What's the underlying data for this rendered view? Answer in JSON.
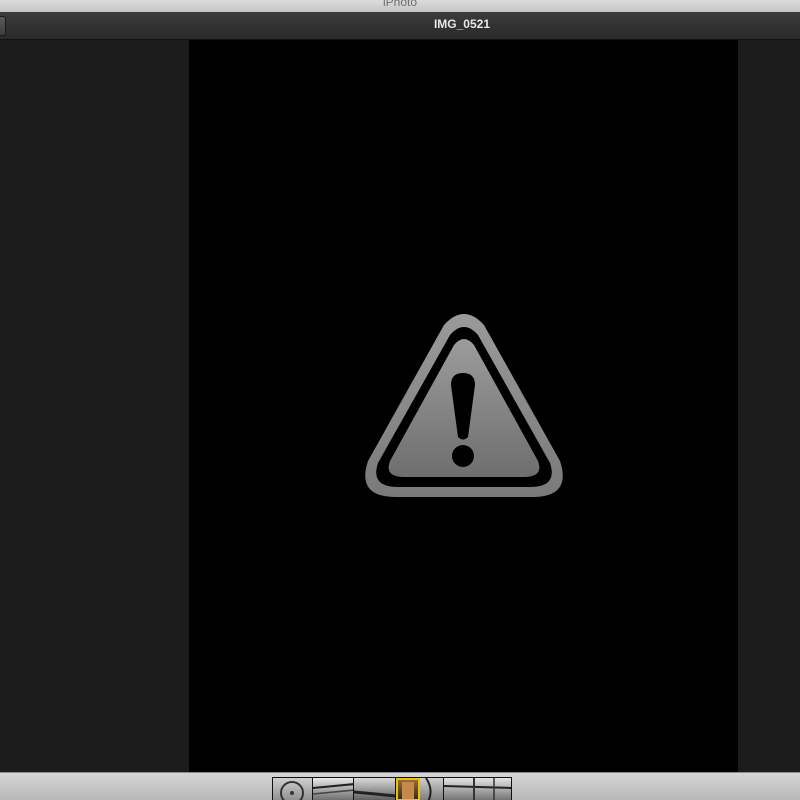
{
  "window": {
    "app_title": "iPhoto"
  },
  "viewer": {
    "photo_title": "IMG_0521",
    "icon": "warning-icon"
  },
  "filmstrip": {
    "thumbnails": [
      {
        "icon": "wheel-thumbnail"
      },
      {
        "icon": "bicycle-thumbnail"
      },
      {
        "icon": "bicycle-thumbnail"
      },
      {
        "icon": "door-thumbnail",
        "selected": true
      },
      {
        "icon": "wheel-thumbnail"
      },
      {
        "icon": "bicycle-thumbnail"
      }
    ],
    "selected_color": "#e8c400"
  }
}
